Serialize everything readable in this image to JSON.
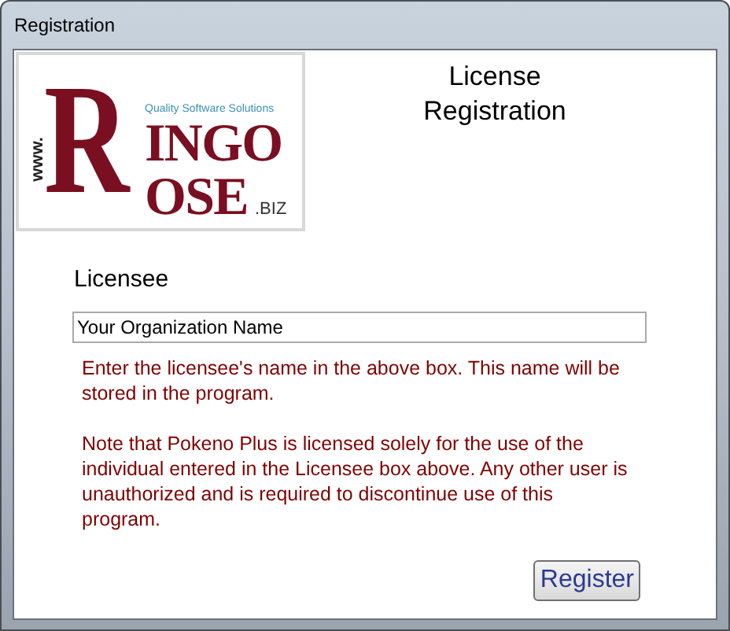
{
  "window": {
    "title": "Registration"
  },
  "logo": {
    "prefix": "www.",
    "initial": "R",
    "line_1": "INGO",
    "line_2": "OSE",
    "suffix": ".BIZ",
    "tagline": "Quality Software Solutions"
  },
  "heading": [
    "License",
    "Registration"
  ],
  "licensee": {
    "label": "Licensee",
    "value": "Your Organization Name"
  },
  "notes": [
    "Enter the licensee's name in the above box. This name will be stored in the program.",
    "Note that Pokeno Plus is licensed solely for the use of the individual entered in the Licensee box above. Any other user is unauthorized and is required to discontinue use of this program."
  ],
  "buttons": [
    "Register"
  ]
}
